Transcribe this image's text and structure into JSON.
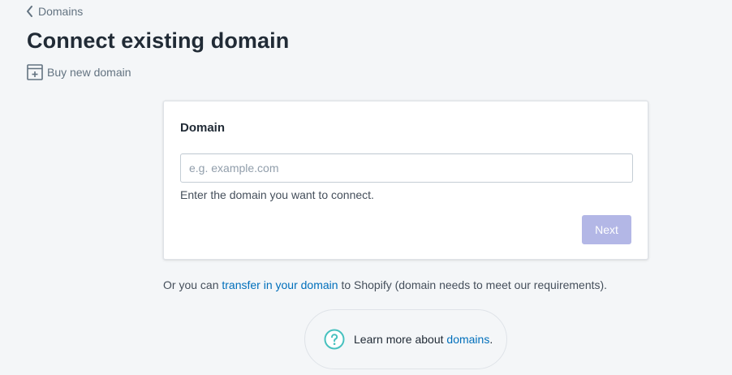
{
  "breadcrumb": {
    "label": "Domains"
  },
  "page": {
    "title": "Connect existing domain",
    "secondary_action": "Buy new domain"
  },
  "card": {
    "title": "Domain",
    "input": {
      "placeholder": "e.g. example.com",
      "value": ""
    },
    "help_text": "Enter the domain you want to connect.",
    "next_label": "Next"
  },
  "transfer": {
    "prefix": "Or you can ",
    "link": "transfer in your domain",
    "suffix": " to Shopify (domain needs to meet our requirements)."
  },
  "footer_help": {
    "prefix": "Learn more about ",
    "link": "domains",
    "suffix": "."
  },
  "colors": {
    "background": "#f4f6f8",
    "link": "#006fbb",
    "primary_disabled": "#b3b7e6",
    "help_icon": "#47c1bf"
  },
  "icons": [
    "chevron-left-icon",
    "buy-domain-icon",
    "question-circle-icon"
  ]
}
